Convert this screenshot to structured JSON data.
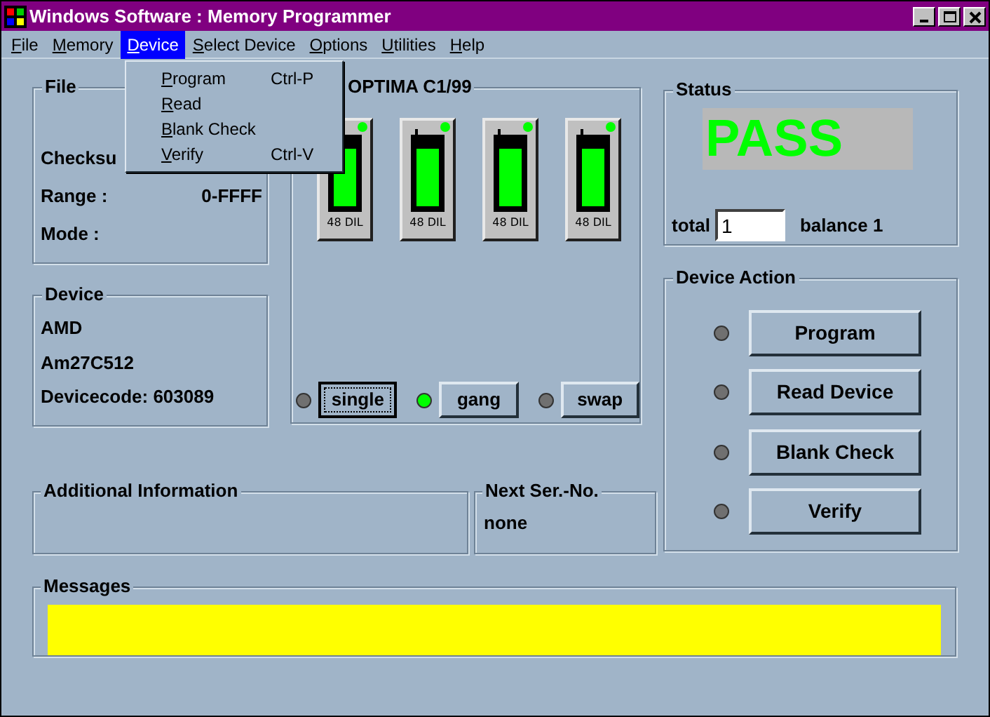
{
  "window": {
    "title": "Windows Software : Memory Programmer"
  },
  "menu": [
    {
      "label": "File",
      "selected": false
    },
    {
      "label": "Memory",
      "selected": false
    },
    {
      "label": "Device",
      "selected": true
    },
    {
      "label": "Select Device",
      "selected": false
    },
    {
      "label": "Options",
      "selected": false
    },
    {
      "label": "Utilities",
      "selected": false
    },
    {
      "label": "Help",
      "selected": false
    }
  ],
  "dropdown": [
    {
      "label": "Program",
      "shortcut": "Ctrl-P"
    },
    {
      "label": "Read"
    },
    {
      "label": "Blank Check"
    },
    {
      "label": "Verify",
      "shortcut": "Ctrl-V"
    }
  ],
  "file_group": {
    "title": "File",
    "rows": [
      {
        "label": "Checksu"
      },
      {
        "label": "Range :",
        "value": "0-FFFF"
      },
      {
        "label": "Mode :"
      }
    ]
  },
  "device_group": {
    "title": "Device",
    "lines": [
      "AMD",
      "Am27C512",
      "Devicecode: 603089"
    ]
  },
  "programmer": {
    "title": "OPTIMA  C1/99",
    "sockets": [
      {
        "label": "48 DIL",
        "led_on": true
      },
      {
        "label": "48 DIL",
        "led_on": true
      },
      {
        "label": "48 DIL",
        "led_on": true
      },
      {
        "label": "48 DIL",
        "led_on": true
      }
    ],
    "modes": [
      {
        "label": "single",
        "led_on": false,
        "focused": true
      },
      {
        "label": "gang",
        "led_on": true,
        "focused": false
      },
      {
        "label": "swap",
        "led_on": false,
        "focused": false
      }
    ]
  },
  "status": {
    "title": "Status",
    "result": "PASS",
    "total_label": "total",
    "total_value": "1",
    "balance": "balance 1"
  },
  "device_action": {
    "title": "Device Action",
    "actions": [
      {
        "label": "Program",
        "led_on": false
      },
      {
        "label": "Read Device",
        "led_on": false
      },
      {
        "label": "Blank Check",
        "led_on": false
      },
      {
        "label": "Verify",
        "led_on": false
      }
    ]
  },
  "additional_info": {
    "title": "Additional Information"
  },
  "next_serial": {
    "title": "Next Ser.-No.",
    "value": "none"
  },
  "messages": {
    "title": "Messages"
  }
}
